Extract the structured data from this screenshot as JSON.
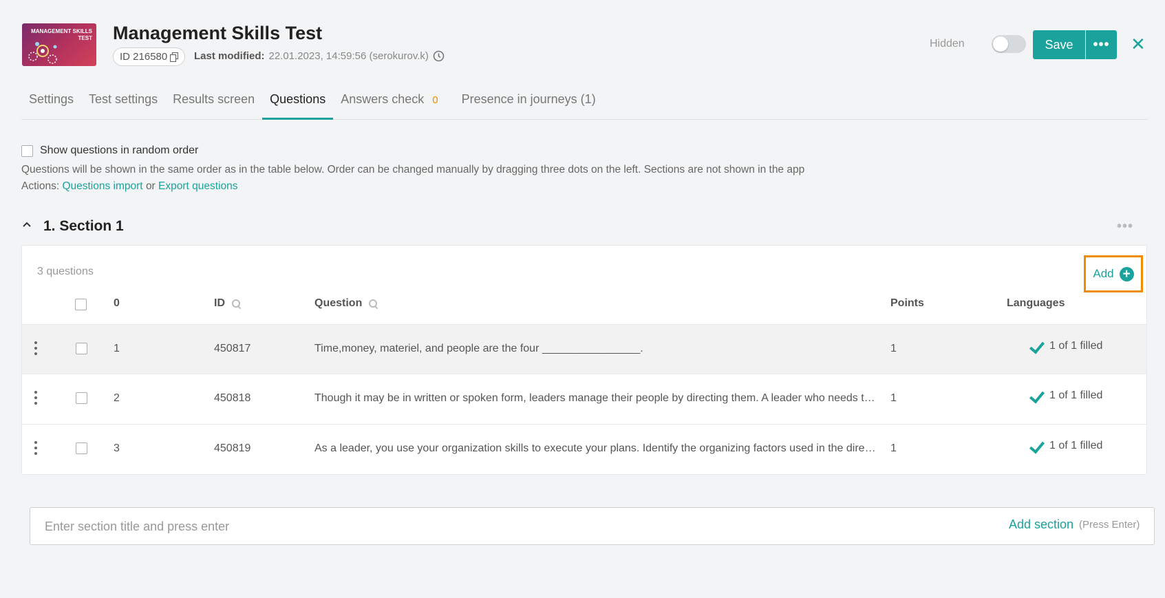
{
  "header": {
    "thumbnail_text": "MANAGEMENT SKILLS TEST",
    "title": "Management Skills Test",
    "id_label": "ID 216580",
    "last_modified_label": "Last modified:",
    "last_modified_value": "22.01.2023, 14:59:56 (serokurov.k)",
    "visibility_label": "Hidden",
    "save_label": "Save"
  },
  "tabs": [
    {
      "label": "Settings"
    },
    {
      "label": "Test settings"
    },
    {
      "label": "Results screen"
    },
    {
      "label": "Questions"
    },
    {
      "label": "Answers check",
      "count": "0"
    },
    {
      "label": "Presence in journeys (1)"
    }
  ],
  "options": {
    "random_order_label": "Show questions in random order",
    "info_text": "Questions will be shown in the same order as in the table below. Order can be changed manually by dragging three dots on the left. Sections are not shown in the app",
    "actions_prefix": "Actions:",
    "import_link": "Questions import",
    "or_text": "or",
    "export_link": "Export questions"
  },
  "section": {
    "title": "1. Section 1",
    "question_count": "3 questions",
    "add_label": "Add",
    "columns": {
      "number": "0",
      "id": "ID",
      "question": "Question",
      "points": "Points",
      "languages": "Languages"
    },
    "rows": [
      {
        "number": "1",
        "id": "450817",
        "question": "Time,money, materiel, and people are the four ________________.",
        "points": "1",
        "languages": "1 of 1 filled"
      },
      {
        "number": "2",
        "id": "450818",
        "question": "Though it may be in written or spoken form, leaders manage their people by directing them. A leader who needs to communicate effectively must be able to understand the situation",
        "points": "1",
        "languages": "1 of 1 filled"
      },
      {
        "number": "3",
        "id": "450819",
        "question": "As a leader, you use your organization skills to execute your plans. Identify the organizing factors used in the direction of the team",
        "points": "1",
        "languages": "1 of 1 filled"
      }
    ]
  },
  "new_section": {
    "placeholder": "Enter section title and press enter",
    "add_label": "Add section",
    "hint": "(Press Enter)"
  }
}
